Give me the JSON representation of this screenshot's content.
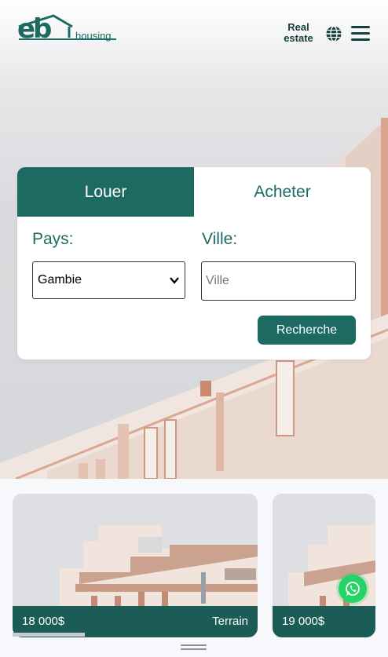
{
  "brand": {
    "logo_mark": "eb",
    "logo_text": "housing"
  },
  "header": {
    "real_estate_label": "Real estate",
    "icons": [
      "globe-icon",
      "menu-icon"
    ]
  },
  "search": {
    "tabs": [
      {
        "label": "Louer",
        "active": true
      },
      {
        "label": "Acheter",
        "active": false
      }
    ],
    "country_label": "Pays:",
    "country_value": "Gambie",
    "city_label": "Ville:",
    "city_placeholder": "Ville",
    "submit_label": "Recherche"
  },
  "listings": [
    {
      "price": "18 000$",
      "type": "Terrain"
    },
    {
      "price": "19 000$",
      "type": ""
    }
  ],
  "floating": {
    "icon": "whatsapp-icon",
    "color": "#25d366"
  },
  "colors": {
    "brand": "#1d6a63",
    "listing_bar": "#1b5c56"
  }
}
